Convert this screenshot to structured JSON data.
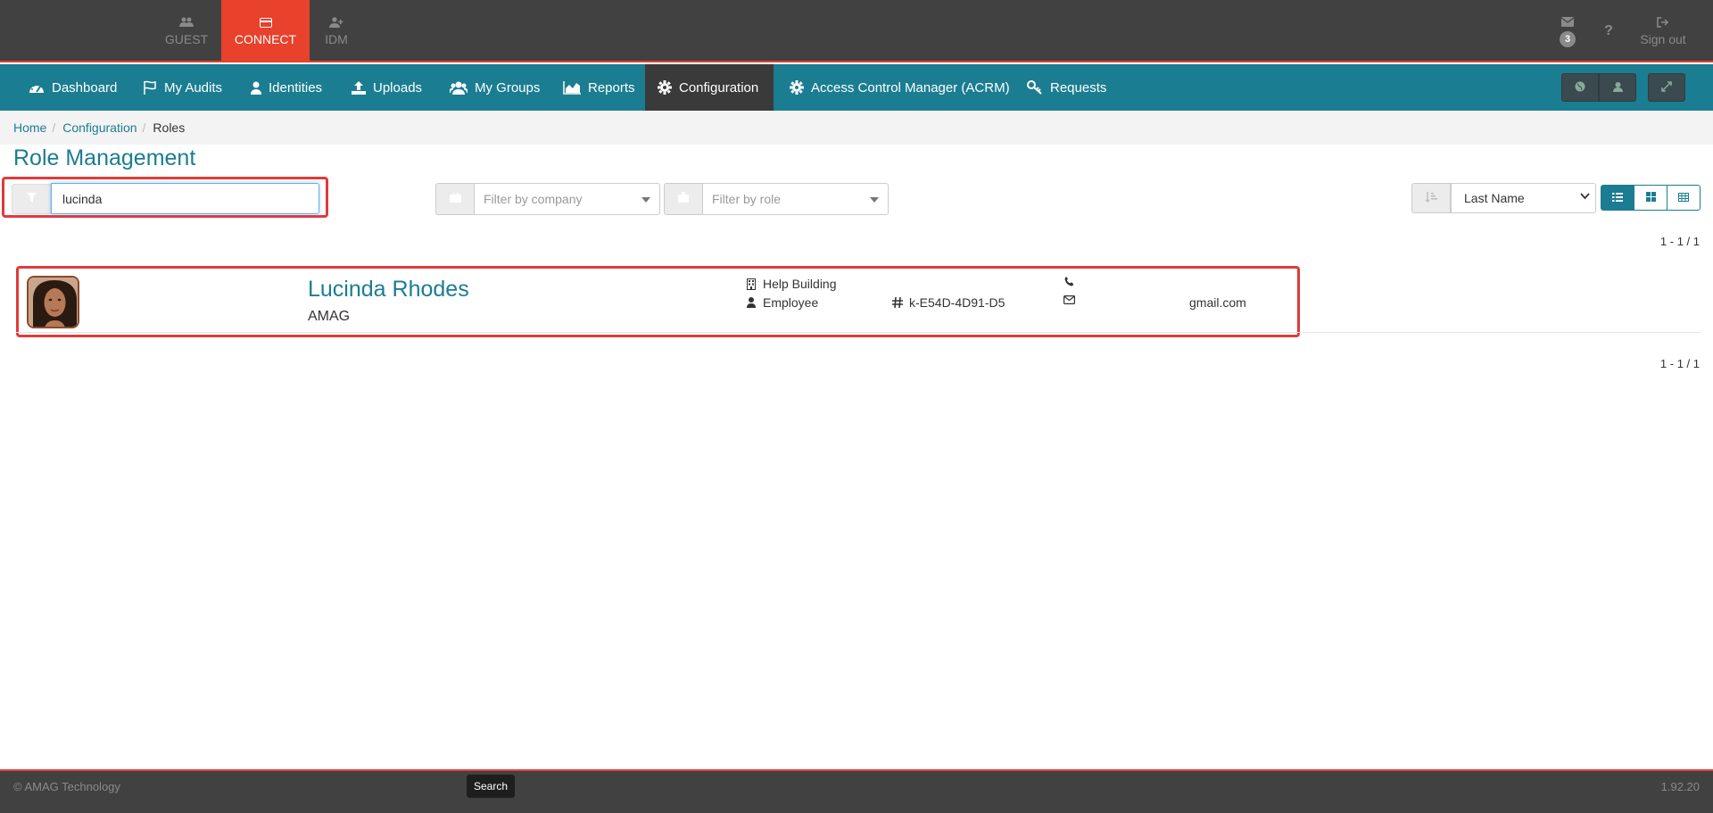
{
  "topbar": {
    "apps": [
      {
        "label": "GUEST",
        "icon": "users-icon"
      },
      {
        "label": "CONNECT",
        "icon": "card-icon"
      },
      {
        "label": "IDM",
        "icon": "user-plus-icon"
      }
    ],
    "mail_count": "3",
    "help_label": "?",
    "signout_label": "Sign out"
  },
  "nav": {
    "items": [
      {
        "label": "Dashboard",
        "icon": "dashboard-icon"
      },
      {
        "label": "My Audits",
        "icon": "flag-icon"
      },
      {
        "label": "Identities",
        "icon": "user-icon"
      },
      {
        "label": "Uploads",
        "icon": "upload-icon"
      },
      {
        "label": "My Groups",
        "icon": "users-icon"
      },
      {
        "label": "Reports",
        "icon": "area-chart-icon"
      },
      {
        "label": "Configuration",
        "icon": "gear-icon"
      },
      {
        "label": "Access Control Manager (ACRM)",
        "icon": "gear-icon"
      },
      {
        "label": "Requests",
        "icon": "key-icon"
      }
    ],
    "active": "Configuration"
  },
  "breadcrumb": {
    "items": [
      "Home",
      "Configuration",
      "Roles"
    ],
    "separator": "/"
  },
  "page": {
    "title": "Role Management"
  },
  "filters": {
    "search_value": "lucinda",
    "company_placeholder": "Filter by company",
    "role_placeholder": "Filter by role",
    "sort_value": "Last Name"
  },
  "pagination": {
    "top": "1 - 1 / 1",
    "bottom": "1 - 1 / 1"
  },
  "results": [
    {
      "name": "Lucinda Rhodes",
      "company": "AMAG",
      "building": "Help Building",
      "role": "Employee",
      "id": "k-E54D-4D91-D5",
      "phone": "",
      "email": "gmail.com"
    }
  ],
  "footer": {
    "copyright": "© AMAG Technology",
    "version": "1.92.20",
    "tooltip": "Search"
  },
  "colors": {
    "brand_teal": "#1b7d91",
    "accent_red": "#e8412c",
    "topbar": "#414141"
  }
}
